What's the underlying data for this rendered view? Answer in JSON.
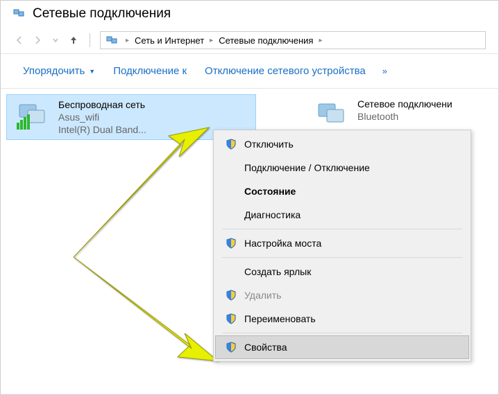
{
  "window": {
    "title": "Сетевые подключения"
  },
  "breadcrumbs": {
    "item1": "Сеть и Интернет",
    "item2": "Сетевые подключения"
  },
  "toolbar": {
    "organize": "Упорядочить",
    "connect": "Подключение к",
    "disable": "Отключение сетевого устройства",
    "overflow": "»"
  },
  "adapters": {
    "wifi": {
      "name": "Беспроводная сеть",
      "ssid": "Asus_wifi",
      "driver": "Intel(R) Dual Band..."
    },
    "bluetooth": {
      "name": "Сетевое подключени",
      "ssid": "Bluetooth"
    }
  },
  "context_menu": {
    "disable": "Отключить",
    "connect_disconnect": "Подключение / Отключение",
    "status": "Состояние",
    "diagnostics": "Диагностика",
    "bridge": "Настройка моста",
    "shortcut": "Создать ярлык",
    "delete": "Удалить",
    "rename": "Переименовать",
    "properties": "Свойства"
  }
}
